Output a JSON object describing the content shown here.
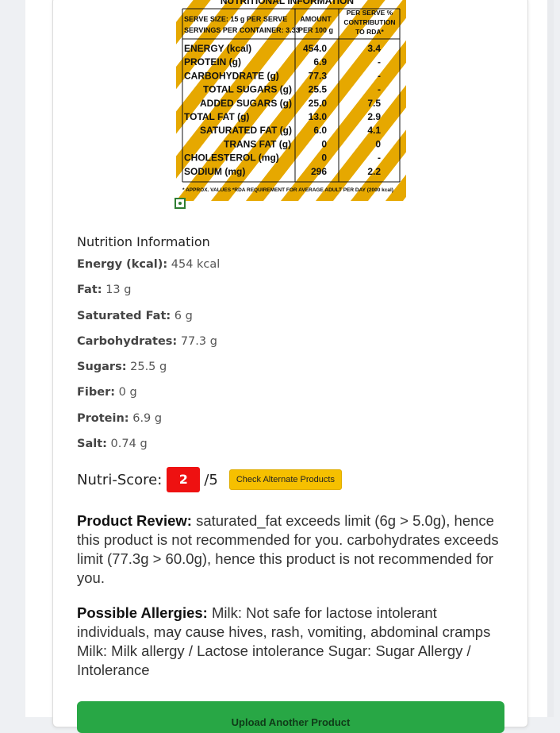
{
  "label_image": {
    "heading": "NUTRITIONAL INFORMATION",
    "serve_size": "SERVE SIZE: 15 g PER SERVE",
    "servings": "SERVINGS PER CONTAINER: 3.33",
    "col_amount": "AMOUNT",
    "col_amount_sub": "PER 100 g",
    "col_rda": "PER SERVE %",
    "col_rda_sub1": "CONTRIBUTION",
    "col_rda_sub2": "TO RDA*",
    "rows": [
      {
        "name": "ENERGY (kcal)",
        "amount": "454.0",
        "rda": "3.4"
      },
      {
        "name": "PROTEIN (g)",
        "amount": "6.9",
        "rda": "-"
      },
      {
        "name": "CARBOHYDRATE (g)",
        "amount": "77.3",
        "rda": "-"
      },
      {
        "name": "TOTAL SUGARS (g)",
        "amount": "25.5",
        "rda": "-"
      },
      {
        "name": "ADDED SUGARS (g)",
        "amount": "25.0",
        "rda": "7.5"
      },
      {
        "name": "TOTAL FAT (g)",
        "amount": "13.0",
        "rda": "2.9"
      },
      {
        "name": "SATURATED FAT (g)",
        "amount": "6.0",
        "rda": "4.1"
      },
      {
        "name": "TRANS FAT (g)",
        "amount": "0",
        "rda": "0"
      },
      {
        "name": "CHOLESTEROL (mg)",
        "amount": "0",
        "rda": "-"
      },
      {
        "name": "SODIUM (mg)",
        "amount": "296",
        "rda": "2.2"
      }
    ],
    "footnote": "* APPROX. VALUES  *RDA REQUIREMENT FOR AVERAGE ADULT PER DAY (2000 kcal)",
    "stripe_color": "#e6a800"
  },
  "nutrition": {
    "title": "Nutrition Information",
    "items": [
      {
        "label": "Energy (kcal):",
        "value": "454 kcal"
      },
      {
        "label": "Fat:",
        "value": "13 g"
      },
      {
        "label": "Saturated Fat:",
        "value": "6 g"
      },
      {
        "label": "Carbohydrates:",
        "value": "77.3 g"
      },
      {
        "label": "Sugars:",
        "value": "25.5 g"
      },
      {
        "label": "Fiber:",
        "value": "0 g"
      },
      {
        "label": "Protein:",
        "value": "6.9 g"
      },
      {
        "label": "Salt:",
        "value": "0.74 g"
      }
    ]
  },
  "score": {
    "label": "Nutri-Score:",
    "value": "2",
    "max": "/5",
    "badge_color": "#ee1111",
    "alt_button": "Check Alternate Products"
  },
  "review": {
    "label": "Product Review:",
    "text": "saturated_fat exceeds limit (6g > 5.0g), hence this product is not recommended for you. carbohydrates exceeds limit (77.3g > 60.0g), hence this product is not recommended for you."
  },
  "allergies": {
    "label": "Possible Allergies:",
    "text": "Milk: Not safe for lactose intolerant individuals, may cause hives, rash, vomiting, abdominal cramps Milk: Milk allergy / Lactose intolerance Sugar: Sugar Allergy / Intolerance"
  },
  "upload_button": "Upload Another Product",
  "colors": {
    "upload": "#28a745",
    "alt_button": "#f6c000"
  }
}
